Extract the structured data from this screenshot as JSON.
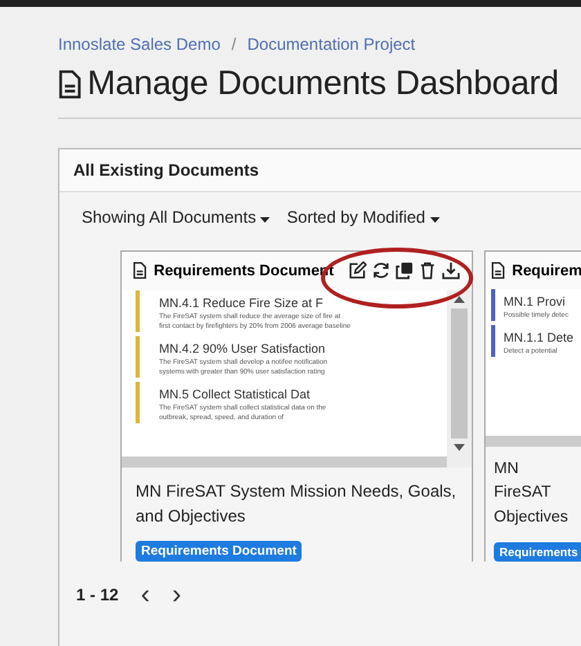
{
  "breadcrumb": [
    {
      "label": "Innoslate Sales Demo"
    },
    {
      "label": "Documentation Project"
    }
  ],
  "breadcrumb_separator": "/",
  "title": "Manage Documents Dashboard",
  "panel": {
    "title": "All Existing Documents",
    "filters": [
      {
        "label": "Showing All Documents"
      },
      {
        "label": "Sorted by Modified"
      }
    ],
    "cards": [
      {
        "header": "Requirements Document",
        "title": "MN FireSAT System Mission Needs, Goals, and Objectives",
        "badge": "Requirements Document",
        "show_actions": true,
        "color": "#d9b83a",
        "preview": [
          {
            "heading": "MN.4.1 Reduce Fire Size at F",
            "body": "The FireSAT system shall reduce the average size of fire at first contact by firefighters by 20% from 2006 average baseline"
          },
          {
            "heading": "MN.4.2 90% User Satisfaction",
            "body": "The FireSAT system shall develop a notifee notification systems with greater than 90% user satisfaction rating"
          },
          {
            "heading": "MN.5 Collect Statistical Dat",
            "body": "The FireSAT system shall collect statistical data on the outbreak, spread, speed, and duration of"
          }
        ]
      },
      {
        "header": "Requirem",
        "title": "MN FireSAT Objectives",
        "badge": "Requirements",
        "show_actions": false,
        "color": "#4a63c8",
        "preview": [
          {
            "heading": "MN.1 Provi",
            "body": "Possible timely detec"
          },
          {
            "heading": "MN.1.1 Dete",
            "body": "Detect a potential"
          }
        ]
      }
    ],
    "pager": {
      "range": "1 - 12",
      "prev": "‹",
      "next": "›"
    }
  }
}
